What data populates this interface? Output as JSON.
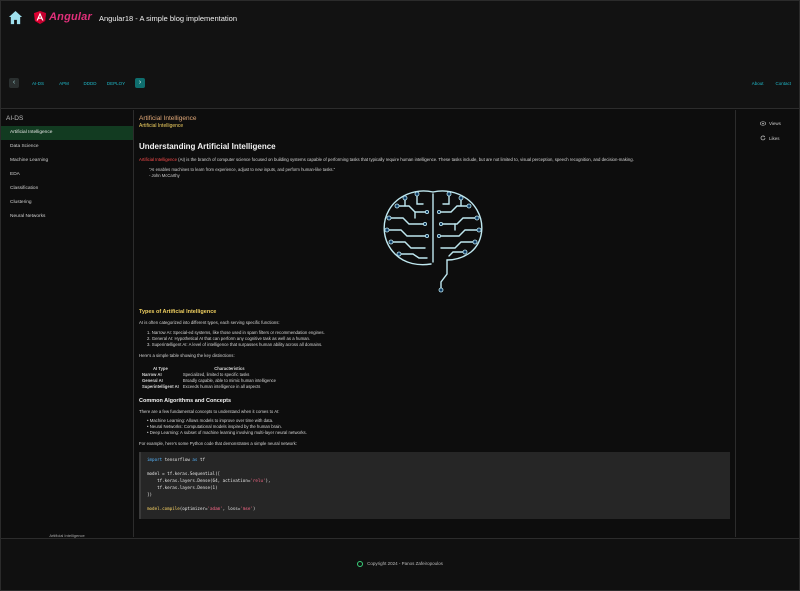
{
  "header": {
    "brand": "Angular",
    "title": "Angular18 - A simple blog implementation",
    "nav_links": [
      "AI-DS",
      "APM",
      "DDDD",
      "DEPLOY"
    ],
    "right_links": [
      "About",
      "Contact"
    ],
    "accent": "#1fb8c8",
    "brand_color": "#e0307a"
  },
  "sidebar": {
    "title": "AI-DS",
    "items": [
      {
        "label": "Artificial Intelligence",
        "active": true
      },
      {
        "label": "Data Science"
      },
      {
        "label": "Machine Learning"
      },
      {
        "label": "EDA"
      },
      {
        "label": "Classification"
      },
      {
        "label": "Clustering"
      },
      {
        "label": "Neural Networks"
      }
    ],
    "footer": "Artificial Intelligence"
  },
  "right_panel": {
    "views": "Views",
    "likes": "Likes"
  },
  "article": {
    "category": "Artificial Intelligence",
    "subcategory": "Artificial Intelligence",
    "heading": "Understanding Artificial Intelligence",
    "intro_highlight": "Artificial Intelligence",
    "intro_rest": " (AI) is the branch of computer science focused on building systems capable of performing tasks that typically require human intelligence. These tasks include, but are not limited to, visual perception, speech recognition, and decision-making.",
    "quote": "\"AI enables machines to learn from experience, adjust to new inputs, and perform human-like tasks.\"",
    "quote_author": "- John McCarthy",
    "types_heading": "Types of Artificial Intelligence",
    "types_intro": "AI is often categorized into different types, each serving specific functions:",
    "types_list": [
      "1. Narrow AI: Special-ed systems, like those used in spam filters or recommendation engines.",
      "2. General AI: Hypothetical AI that can perform any cognitive task as well as a human.",
      "3. Superintelligent AI: A level of intelligence that surpasses human ability across all domains."
    ],
    "table_intro": "Here's a simple table showing the key distinctions:",
    "table": {
      "headers": [
        "AI Type",
        "Characteristics"
      ],
      "rows": [
        [
          "Narrow AI",
          "Specialized, limited to specific tasks"
        ],
        [
          "General AI",
          "Broadly capable, able to mimic human intelligence"
        ],
        [
          "Superintelligent AI",
          "Exceeds human intelligence in all aspects"
        ]
      ]
    },
    "algo_heading": "Common Algorithms and Concepts",
    "algo_intro": "There are a few fundamental concepts to understand when it comes to AI:",
    "algo_list": [
      "• Machine Learning: Allows models to improve over time with data.",
      "• Neural Networks: Computational models inspired by the human brain.",
      "• Deep Learning: A subset of machine learning involving multi-layer neural networks."
    ],
    "code_intro": "For example, here's some Python code that demonstrates a simple neural network:",
    "code": {
      "line1_kw": "import",
      "line1_rest": " tensorflow ",
      "line1_kw2": "as",
      "line1_end": " tf",
      "line2": "model = tf.keras.Sequential([",
      "line3_a": "    tf.keras.layers.Dense(64, activation=",
      "line3_str": "'relu'",
      "line3_b": "),",
      "line4": "    tf.keras.layers.Dense(1)",
      "line5": "])",
      "line6_fn": "model.compile",
      "line6_a": "(optimizer=",
      "line6_str1": "'adam'",
      "line6_b": ", loss=",
      "line6_str2": "'mse'",
      "line6_c": ")"
    }
  },
  "footer": {
    "copyright": "Copyright 2024 - Panos Zafeiropoulos"
  }
}
